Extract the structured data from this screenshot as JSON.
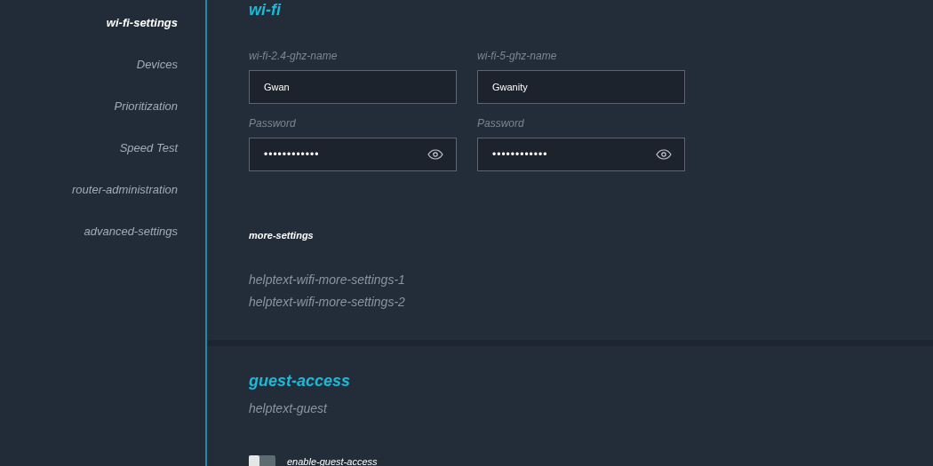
{
  "sidebar": {
    "items": [
      {
        "label": "wi-fi-settings",
        "selected": true
      },
      {
        "label": "Devices",
        "selected": false
      },
      {
        "label": "Prioritization",
        "selected": false
      },
      {
        "label": "Speed Test",
        "selected": false
      },
      {
        "label": "router-administration",
        "selected": false
      },
      {
        "label": "advanced-settings",
        "selected": false
      }
    ]
  },
  "wifi": {
    "title": "wi-fi",
    "fields": [
      {
        "label": "wi-fi-2.4-ghz-name",
        "value": "Gwan",
        "kind": "text"
      },
      {
        "label": "wi-fi-5-ghz-name",
        "value": "Gwanity",
        "kind": "text"
      },
      {
        "label": "Password",
        "value": "••••••••••••",
        "kind": "password"
      },
      {
        "label": "Password",
        "value": "••••••••••••",
        "kind": "password"
      }
    ],
    "more_settings": {
      "title": "more-settings",
      "help": [
        "helptext-wifi-more-settings-1",
        "helptext-wifi-more-settings-2"
      ]
    }
  },
  "guest": {
    "title": "guest-access",
    "help": "helptext-guest",
    "toggle": {
      "label": "enable-guest-access",
      "on": false
    }
  }
}
